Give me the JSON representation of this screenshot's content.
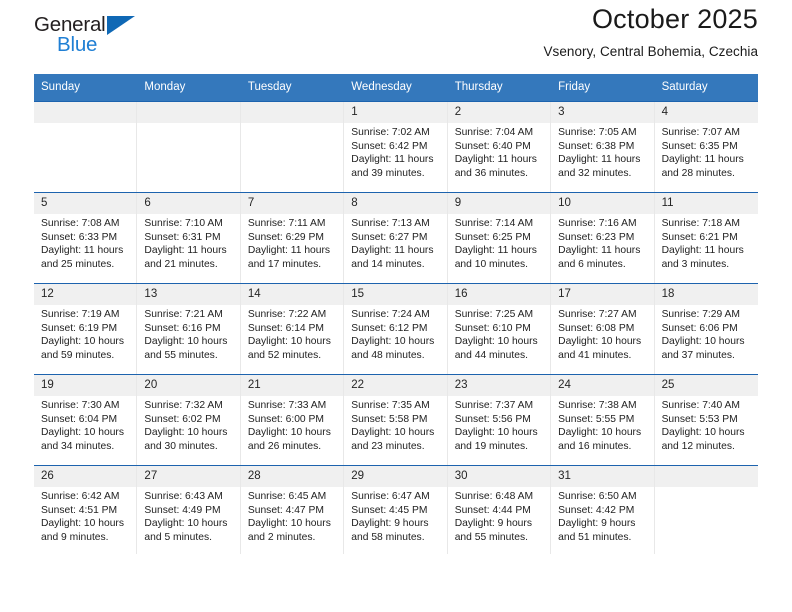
{
  "brand": {
    "name_top": "General",
    "name_bottom": "Blue",
    "triangle_color": "#0f68b5",
    "blue_text_color": "#1f7fd4"
  },
  "header": {
    "title": "October 2025",
    "subtitle": "Vsenory, Central Bohemia, Czechia"
  },
  "theme": {
    "header_bar": "#3478bc",
    "week_rule": "#1d63ae",
    "day_strip": "#f0f0f0",
    "cell_bg": "#ffffff"
  },
  "weekdays": [
    "Sunday",
    "Monday",
    "Tuesday",
    "Wednesday",
    "Thursday",
    "Friday",
    "Saturday"
  ],
  "weeks": [
    [
      {
        "day": "",
        "empty": true
      },
      {
        "day": "",
        "empty": true
      },
      {
        "day": "",
        "empty": true
      },
      {
        "day": "1",
        "sunrise": "Sunrise: 7:02 AM",
        "sunset": "Sunset: 6:42 PM",
        "daylight": "Daylight: 11 hours and 39 minutes."
      },
      {
        "day": "2",
        "sunrise": "Sunrise: 7:04 AM",
        "sunset": "Sunset: 6:40 PM",
        "daylight": "Daylight: 11 hours and 36 minutes."
      },
      {
        "day": "3",
        "sunrise": "Sunrise: 7:05 AM",
        "sunset": "Sunset: 6:38 PM",
        "daylight": "Daylight: 11 hours and 32 minutes."
      },
      {
        "day": "4",
        "sunrise": "Sunrise: 7:07 AM",
        "sunset": "Sunset: 6:35 PM",
        "daylight": "Daylight: 11 hours and 28 minutes."
      }
    ],
    [
      {
        "day": "5",
        "sunrise": "Sunrise: 7:08 AM",
        "sunset": "Sunset: 6:33 PM",
        "daylight": "Daylight: 11 hours and 25 minutes."
      },
      {
        "day": "6",
        "sunrise": "Sunrise: 7:10 AM",
        "sunset": "Sunset: 6:31 PM",
        "daylight": "Daylight: 11 hours and 21 minutes."
      },
      {
        "day": "7",
        "sunrise": "Sunrise: 7:11 AM",
        "sunset": "Sunset: 6:29 PM",
        "daylight": "Daylight: 11 hours and 17 minutes."
      },
      {
        "day": "8",
        "sunrise": "Sunrise: 7:13 AM",
        "sunset": "Sunset: 6:27 PM",
        "daylight": "Daylight: 11 hours and 14 minutes."
      },
      {
        "day": "9",
        "sunrise": "Sunrise: 7:14 AM",
        "sunset": "Sunset: 6:25 PM",
        "daylight": "Daylight: 11 hours and 10 minutes."
      },
      {
        "day": "10",
        "sunrise": "Sunrise: 7:16 AM",
        "sunset": "Sunset: 6:23 PM",
        "daylight": "Daylight: 11 hours and 6 minutes."
      },
      {
        "day": "11",
        "sunrise": "Sunrise: 7:18 AM",
        "sunset": "Sunset: 6:21 PM",
        "daylight": "Daylight: 11 hours and 3 minutes."
      }
    ],
    [
      {
        "day": "12",
        "sunrise": "Sunrise: 7:19 AM",
        "sunset": "Sunset: 6:19 PM",
        "daylight": "Daylight: 10 hours and 59 minutes."
      },
      {
        "day": "13",
        "sunrise": "Sunrise: 7:21 AM",
        "sunset": "Sunset: 6:16 PM",
        "daylight": "Daylight: 10 hours and 55 minutes."
      },
      {
        "day": "14",
        "sunrise": "Sunrise: 7:22 AM",
        "sunset": "Sunset: 6:14 PM",
        "daylight": "Daylight: 10 hours and 52 minutes."
      },
      {
        "day": "15",
        "sunrise": "Sunrise: 7:24 AM",
        "sunset": "Sunset: 6:12 PM",
        "daylight": "Daylight: 10 hours and 48 minutes."
      },
      {
        "day": "16",
        "sunrise": "Sunrise: 7:25 AM",
        "sunset": "Sunset: 6:10 PM",
        "daylight": "Daylight: 10 hours and 44 minutes."
      },
      {
        "day": "17",
        "sunrise": "Sunrise: 7:27 AM",
        "sunset": "Sunset: 6:08 PM",
        "daylight": "Daylight: 10 hours and 41 minutes."
      },
      {
        "day": "18",
        "sunrise": "Sunrise: 7:29 AM",
        "sunset": "Sunset: 6:06 PM",
        "daylight": "Daylight: 10 hours and 37 minutes."
      }
    ],
    [
      {
        "day": "19",
        "sunrise": "Sunrise: 7:30 AM",
        "sunset": "Sunset: 6:04 PM",
        "daylight": "Daylight: 10 hours and 34 minutes."
      },
      {
        "day": "20",
        "sunrise": "Sunrise: 7:32 AM",
        "sunset": "Sunset: 6:02 PM",
        "daylight": "Daylight: 10 hours and 30 minutes."
      },
      {
        "day": "21",
        "sunrise": "Sunrise: 7:33 AM",
        "sunset": "Sunset: 6:00 PM",
        "daylight": "Daylight: 10 hours and 26 minutes."
      },
      {
        "day": "22",
        "sunrise": "Sunrise: 7:35 AM",
        "sunset": "Sunset: 5:58 PM",
        "daylight": "Daylight: 10 hours and 23 minutes."
      },
      {
        "day": "23",
        "sunrise": "Sunrise: 7:37 AM",
        "sunset": "Sunset: 5:56 PM",
        "daylight": "Daylight: 10 hours and 19 minutes."
      },
      {
        "day": "24",
        "sunrise": "Sunrise: 7:38 AM",
        "sunset": "Sunset: 5:55 PM",
        "daylight": "Daylight: 10 hours and 16 minutes."
      },
      {
        "day": "25",
        "sunrise": "Sunrise: 7:40 AM",
        "sunset": "Sunset: 5:53 PM",
        "daylight": "Daylight: 10 hours and 12 minutes."
      }
    ],
    [
      {
        "day": "26",
        "sunrise": "Sunrise: 6:42 AM",
        "sunset": "Sunset: 4:51 PM",
        "daylight": "Daylight: 10 hours and 9 minutes."
      },
      {
        "day": "27",
        "sunrise": "Sunrise: 6:43 AM",
        "sunset": "Sunset: 4:49 PM",
        "daylight": "Daylight: 10 hours and 5 minutes."
      },
      {
        "day": "28",
        "sunrise": "Sunrise: 6:45 AM",
        "sunset": "Sunset: 4:47 PM",
        "daylight": "Daylight: 10 hours and 2 minutes."
      },
      {
        "day": "29",
        "sunrise": "Sunrise: 6:47 AM",
        "sunset": "Sunset: 4:45 PM",
        "daylight": "Daylight: 9 hours and 58 minutes."
      },
      {
        "day": "30",
        "sunrise": "Sunrise: 6:48 AM",
        "sunset": "Sunset: 4:44 PM",
        "daylight": "Daylight: 9 hours and 55 minutes."
      },
      {
        "day": "31",
        "sunrise": "Sunrise: 6:50 AM",
        "sunset": "Sunset: 4:42 PM",
        "daylight": "Daylight: 9 hours and 51 minutes."
      },
      {
        "day": "",
        "empty": true
      }
    ]
  ]
}
